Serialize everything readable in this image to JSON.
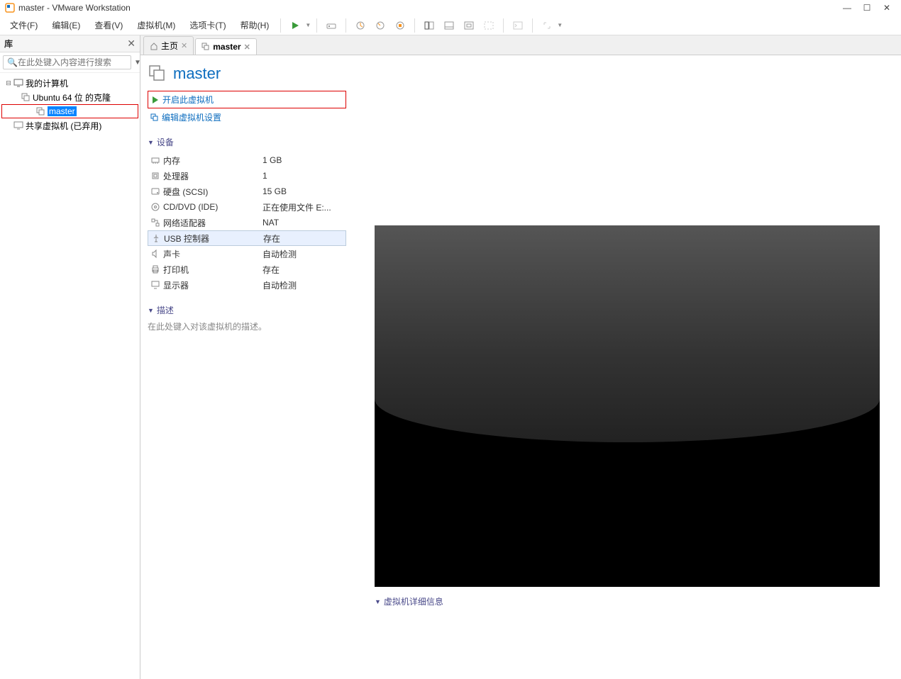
{
  "window": {
    "title": "master - VMware Workstation"
  },
  "menubar": {
    "items": [
      "文件(F)",
      "编辑(E)",
      "查看(V)",
      "虚拟机(M)",
      "选项卡(T)",
      "帮助(H)"
    ]
  },
  "sidebar": {
    "title": "库",
    "search_placeholder": "在此处键入内容进行搜索",
    "tree": {
      "root": "我的计算机",
      "children": [
        "Ubuntu 64 位 的克隆",
        "master"
      ],
      "shared": "共享虚拟机 (已弃用)"
    }
  },
  "tabs": {
    "home": "主页",
    "vm": "master"
  },
  "vm": {
    "name": "master",
    "actions": {
      "power_on": "开启此虚拟机",
      "edit_settings": "编辑虚拟机设置"
    },
    "sections": {
      "devices": "设备",
      "description": "描述",
      "details": "虚拟机详细信息"
    },
    "devices": [
      {
        "name": "内存",
        "value": "1 GB"
      },
      {
        "name": "处理器",
        "value": "1"
      },
      {
        "name": "硬盘 (SCSI)",
        "value": "15 GB"
      },
      {
        "name": "CD/DVD (IDE)",
        "value": "正在使用文件 E:..."
      },
      {
        "name": "网络适配器",
        "value": "NAT"
      },
      {
        "name": "USB 控制器",
        "value": "存在"
      },
      {
        "name": "声卡",
        "value": "自动检测"
      },
      {
        "name": "打印机",
        "value": "存在"
      },
      {
        "name": "显示器",
        "value": "自动检测"
      }
    ],
    "description_placeholder": "在此处键入对该虚拟机的描述。"
  }
}
